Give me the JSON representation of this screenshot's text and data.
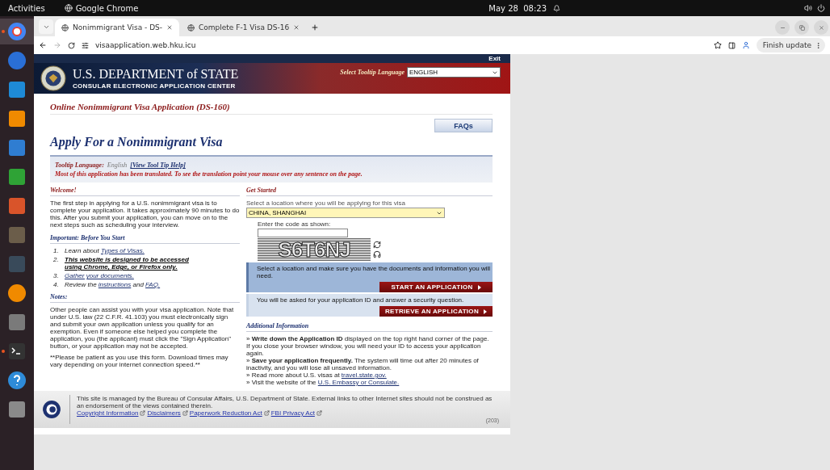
{
  "topbar": {
    "activities": "Activities",
    "app": "Google Chrome",
    "clock": "May 28  08:23"
  },
  "dock": [
    {
      "kind": "chrome",
      "running": true
    },
    {
      "kind": "mail",
      "running": false
    },
    {
      "kind": "code",
      "running": false
    },
    {
      "kind": "cone",
      "running": false
    },
    {
      "kind": "writer",
      "running": false
    },
    {
      "kind": "calc",
      "running": false
    },
    {
      "kind": "impress",
      "running": false
    },
    {
      "kind": "gimp",
      "running": false
    },
    {
      "kind": "scope",
      "running": false
    },
    {
      "kind": "blender",
      "running": false
    },
    {
      "kind": "files",
      "running": false
    },
    {
      "kind": "terminal",
      "running": true
    },
    {
      "kind": "help",
      "running": false
    },
    {
      "kind": "trash",
      "running": false
    }
  ],
  "tabs": [
    {
      "label": "Nonimmigrant Visa - DS-",
      "selected": true
    },
    {
      "label": "Complete F-1 Visa DS-16",
      "selected": false
    }
  ],
  "address": "visaapplication.web.hku.icu",
  "update_button": "Finish update",
  "page": {
    "exit": "Exit",
    "banner_title": "U.S. DEPARTMENT of STATE",
    "banner_subtitle": "CONSULAR ELECTRONIC APPLICATION CENTER",
    "tooltip_select_label": "Select Tooltip Language",
    "tooltip_select_value": "ENGLISH",
    "app_title": "Online Nonimmigrant Visa Application (DS-160)",
    "faqs": "FAQs",
    "heading": "Apply For a Nonimmigrant Visa",
    "tooltip_box": {
      "label": "Tooltip Language:",
      "value": "English",
      "link": "[View Tool Tip Help]",
      "message": "Most of this application has been translated. To see the translation point your mouse over any sentence on the page."
    },
    "left": {
      "welcome_title": "Welcome!",
      "welcome_text": "The first step in applying for a U.S. nonimmigrant visa is to complete your application. It takes approximately 90 minutes to do this. After you submit your application, you can move on to the next steps such as scheduling your interview.",
      "important_title": "Important: Before You Start",
      "steps": [
        {
          "number": "1.",
          "kind": "plain",
          "parts": [
            {
              "text": "Learn about ",
              "kind": "text"
            },
            {
              "text": "Types of Visas.",
              "kind": "link"
            }
          ]
        },
        {
          "number": "2.",
          "kind": "notice",
          "parts": [
            {
              "text": "This website is designed to be accessed using Chrome, Edge, or Firefox only.",
              "kind": "text"
            }
          ]
        },
        {
          "number": "3.",
          "kind": "plain",
          "parts": [
            {
              "text": "Gather your documents.",
              "kind": "link"
            }
          ]
        },
        {
          "number": "4.",
          "kind": "plain",
          "parts": [
            {
              "text": "Review the ",
              "kind": "text"
            },
            {
              "text": "instructions",
              "kind": "link"
            },
            {
              "text": " and ",
              "kind": "text"
            },
            {
              "text": "FAQ.",
              "kind": "link"
            }
          ]
        }
      ],
      "notes_title": "Notes:",
      "notes_text": "Other people can assist you with your visa application. Note that under U.S. law (22 C.F.R. 41.103) you must electronically sign and submit your own application unless you qualify for an exemption. Even if someone else helped you complete the application, you (the applicant) must click the \"Sign Application\" button, or your application may not be accepted.",
      "patience_text": "**Please be patient as you use this form. Download times may vary depending on your internet connection speed.**"
    },
    "right": {
      "get_started": "Get Started",
      "location_label": "Select a location where you will be applying for this visa",
      "location_value": "CHINA, SHANGHAI",
      "code_label": "Enter the code as shown:",
      "captcha": "S6T6NJ",
      "panels": [
        {
          "text": "Select a location and make sure you have the documents and information you will need.",
          "button": "START AN APPLICATION",
          "kind": "start"
        },
        {
          "text": "You will be asked for your application ID and answer a security question.",
          "button": "RETRIEVE AN APPLICATION",
          "kind": "retrieve"
        }
      ],
      "additional_title": "Additional Information",
      "additional": [
        [
          {
            "text": "» **Write down the Application ID** displayed on the top right hand corner of the page. If you close your browser window, you will need your ID to access your application again.",
            "kind": "text"
          }
        ],
        [
          {
            "text": "» **Save your application frequently.** The system will time out after 20 minutes of inactivity, and you will lose all unsaved information.",
            "kind": "text"
          }
        ],
        [
          {
            "text": "» Read more about U.S. visas at ",
            "kind": "text"
          },
          {
            "text": "travel.state.gov.",
            "kind": "link"
          }
        ],
        [
          {
            "text": "» Visit the website of the ",
            "kind": "text"
          },
          {
            "text": "U.S. Embassy or Consulate.",
            "kind": "link"
          }
        ]
      ]
    },
    "footer": {
      "text": "This site is managed by the Bureau of Consular Affairs, U.S. Department of State. External links to other Internet sites should not be construed as an endorsement of the views contained therein.",
      "links": [
        "Copyright Information",
        "Disclaimers",
        "Paperwork Reduction Act",
        "FBI Privacy Act"
      ],
      "code": "(203)"
    }
  }
}
